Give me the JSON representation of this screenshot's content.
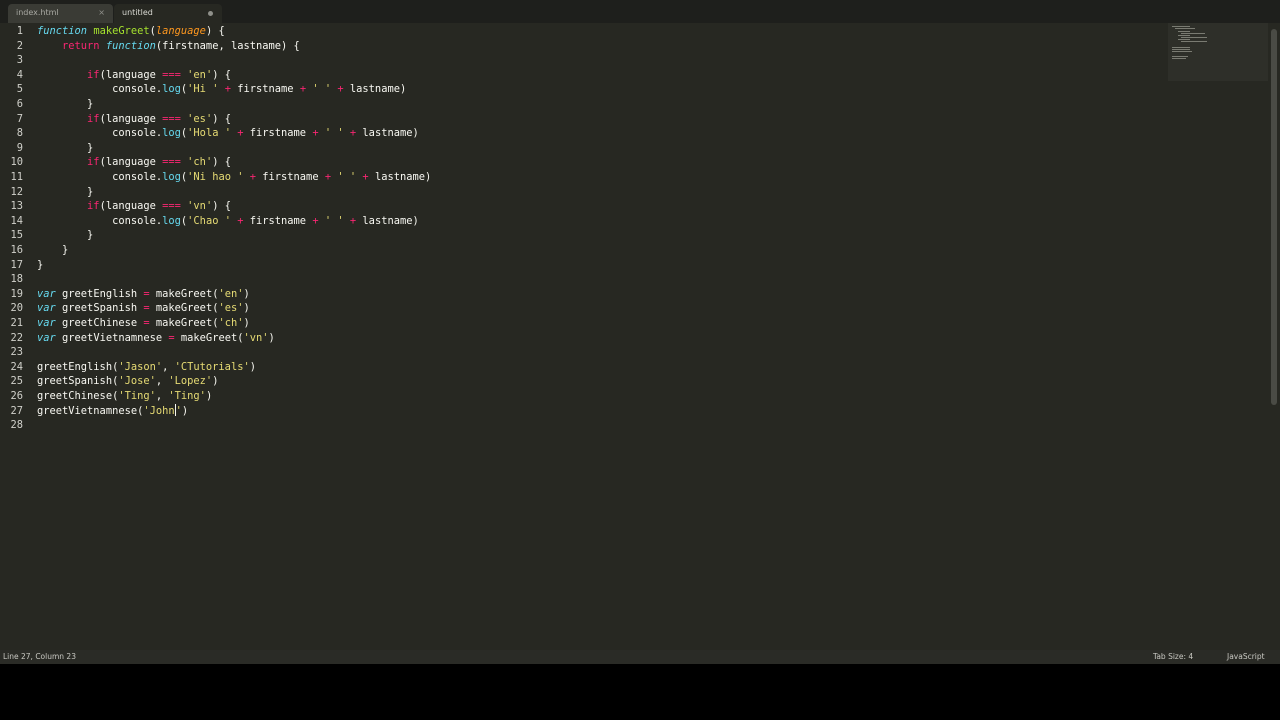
{
  "tabs": [
    {
      "label": "index.html",
      "close": "×",
      "active": false
    },
    {
      "label": "untitled",
      "active": true
    }
  ],
  "status": {
    "position": "Line 27, Column 23",
    "tab_size": "Tab Size: 4",
    "syntax": "JavaScript"
  },
  "code_lines": [
    {
      "n": "1"
    },
    {
      "n": "2"
    },
    {
      "n": "3"
    },
    {
      "n": "4"
    },
    {
      "n": "5"
    },
    {
      "n": "6"
    },
    {
      "n": "7"
    },
    {
      "n": "8"
    },
    {
      "n": "9"
    },
    {
      "n": "10"
    },
    {
      "n": "11"
    },
    {
      "n": "12"
    },
    {
      "n": "13"
    },
    {
      "n": "14"
    },
    {
      "n": "15"
    },
    {
      "n": "16"
    },
    {
      "n": "17"
    },
    {
      "n": "18"
    },
    {
      "n": "19"
    },
    {
      "n": "20"
    },
    {
      "n": "21"
    },
    {
      "n": "22"
    },
    {
      "n": "23"
    },
    {
      "n": "24"
    },
    {
      "n": "25"
    },
    {
      "n": "26"
    },
    {
      "n": "27"
    },
    {
      "n": "28"
    }
  ],
  "code": {
    "l1": {
      "a": "function",
      "b": " ",
      "c": "makeGreet",
      "d": "(",
      "e": "language",
      "f": ") {"
    },
    "l2": {
      "a": "    ",
      "b": "return",
      "c": " ",
      "d": "function",
      "e": "(firstname, lastname) {"
    },
    "l4": {
      "a": "        ",
      "b": "if",
      "c": "(language ",
      "d": "===",
      "e": " ",
      "f": "'en'",
      "g": ") {"
    },
    "l5": {
      "a": "            console.",
      "b": "log",
      "c": "(",
      "d": "'Hi '",
      "e": " ",
      "f": "+",
      "g": " firstname ",
      "h": "+",
      "i": " ",
      "j": "' '",
      "k": " ",
      "l": "+",
      "m": " lastname)"
    },
    "l6": "        }",
    "l7": {
      "a": "        ",
      "b": "if",
      "c": "(language ",
      "d": "===",
      "e": " ",
      "f": "'es'",
      "g": ") {"
    },
    "l8": {
      "a": "            console.",
      "b": "log",
      "c": "(",
      "d": "'Hola '",
      "e": " ",
      "f": "+",
      "g": " firstname ",
      "h": "+",
      "i": " ",
      "j": "' '",
      "k": " ",
      "l": "+",
      "m": " lastname)"
    },
    "l9": "        }",
    "l10": {
      "a": "        ",
      "b": "if",
      "c": "(language ",
      "d": "===",
      "e": " ",
      "f": "'ch'",
      "g": ") {"
    },
    "l11": {
      "a": "            console.",
      "b": "log",
      "c": "(",
      "d": "'Ni hao '",
      "e": " ",
      "f": "+",
      "g": " firstname ",
      "h": "+",
      "i": " ",
      "j": "' '",
      "k": " ",
      "l": "+",
      "m": " lastname)"
    },
    "l12": "        }",
    "l13": {
      "a": "        ",
      "b": "if",
      "c": "(language ",
      "d": "===",
      "e": " ",
      "f": "'vn'",
      "g": ") {"
    },
    "l14": {
      "a": "            console.",
      "b": "log",
      "c": "(",
      "d": "'Chao '",
      "e": " ",
      "f": "+",
      "g": " firstname ",
      "h": "+",
      "i": " ",
      "j": "' '",
      "k": " ",
      "l": "+",
      "m": " lastname)"
    },
    "l15": "        }",
    "l16": "    }",
    "l17": "}",
    "l19": {
      "a": "var",
      "b": " greetEnglish ",
      "c": "=",
      "d": " makeGreet(",
      "e": "'en'",
      "f": ")"
    },
    "l20": {
      "a": "var",
      "b": " greetSpanish ",
      "c": "=",
      "d": " makeGreet(",
      "e": "'es'",
      "f": ")"
    },
    "l21": {
      "a": "var",
      "b": " greetChinese ",
      "c": "=",
      "d": " makeGreet(",
      "e": "'ch'",
      "f": ")"
    },
    "l22": {
      "a": "var",
      "b": " greetVietnamnese ",
      "c": "=",
      "d": " makeGreet(",
      "e": "'vn'",
      "f": ")"
    },
    "l24": {
      "a": "greetEnglish(",
      "b": "'Jason'",
      "c": ", ",
      "d": "'CTutorials'",
      "e": ")"
    },
    "l25": {
      "a": "greetSpanish(",
      "b": "'Jose'",
      "c": ", ",
      "d": "'Lopez'",
      "e": ")"
    },
    "l26": {
      "a": "greetChinese(",
      "b": "'Ting'",
      "c": ", ",
      "d": "'Ting'",
      "e": ")"
    },
    "l27": {
      "a": "greetVietnamnese(",
      "b": "'John",
      "c": "'",
      "d": ")"
    }
  },
  "colors": {
    "background": "#272822",
    "keyword": "#f92672",
    "string": "#e6db74",
    "function": "#a6e22e",
    "storage": "#66d9ef",
    "parameter": "#fd971f",
    "text": "#f8f8f2"
  }
}
